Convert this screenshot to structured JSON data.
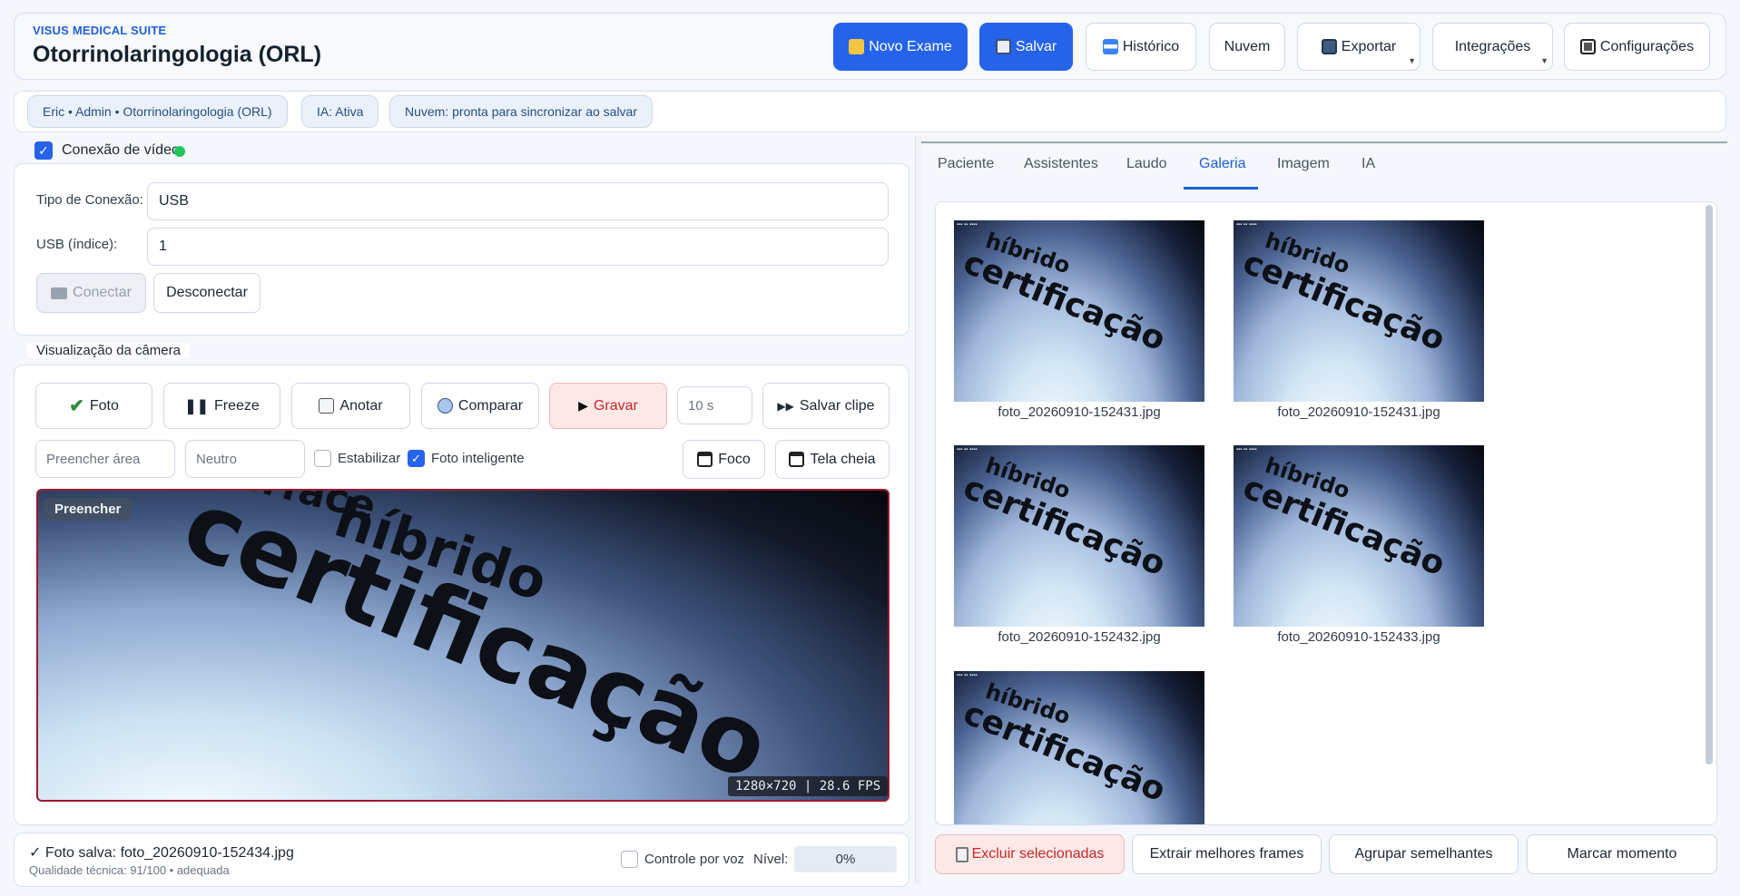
{
  "header": {
    "suite": "VISUS MEDICAL SUITE",
    "title": "Otorrinolaringologia (ORL)",
    "buttons": {
      "new_exam": "Novo Exame",
      "save": "Salvar",
      "history": "Histórico",
      "cloud": "Nuvem",
      "export": "Exportar",
      "integrations": "Integrações",
      "settings": "Configurações"
    }
  },
  "status_chips": {
    "user": "Eric • Admin • Otorrinolaringologia (ORL)",
    "ai": "IA: Ativa",
    "cloud": "Nuvem: pronta para sincronizar ao salvar"
  },
  "video_connection": {
    "label": "Conexão de vídeo",
    "enabled": true,
    "type_label": "Tipo de Conexão:",
    "type_value": "USB",
    "usb_label": "USB (índice):",
    "usb_value": "1",
    "connect": "Conectar",
    "disconnect": "Desconectar"
  },
  "camera": {
    "legend": "Visualização da câmera",
    "photo": "Foto",
    "freeze": "Freeze",
    "annotate": "Anotar",
    "compare": "Comparar",
    "record": "Gravar",
    "duration": "10 s",
    "save_clip": "Salvar clipe",
    "fill_mode": "Preencher área",
    "color_mode": "Neutro",
    "stabilize": "Estabilizar",
    "smart_photo": "Foto inteligente",
    "focus": "Foco",
    "fullscreen": "Tela cheia",
    "fill_badge": "Preencher",
    "stream_info": "1280×720 | 28.6 FPS",
    "video_text_lines": [
      "interface",
      "híbrido",
      "certificação"
    ]
  },
  "status": {
    "saved": "Foto salva: foto_20260910-152434.jpg",
    "quality": "Qualidade técnica: 91/100 • adequada",
    "voice_control": "Controle por voz",
    "level_label": "Nível:",
    "level_value": "0%"
  },
  "tabs": [
    "Paciente",
    "Assistentes",
    "Laudo",
    "Galeria",
    "Imagem",
    "IA"
  ],
  "active_tab": "Galeria",
  "gallery": {
    "thumb_text": [
      "híbrido",
      "certificação"
    ],
    "items": [
      "foto_20260910-152431.jpg",
      "foto_20260910-152431.jpg",
      "foto_20260910-152432.jpg",
      "foto_20260910-152433.jpg",
      ""
    ]
  },
  "gallery_actions": {
    "delete": "Excluir selecionadas",
    "extract": "Extrair melhores frames",
    "group": "Agrupar semelhantes",
    "mark": "Marcar momento"
  },
  "colors": {
    "primary": "#2563eb",
    "danger": "#c62828",
    "live": "#22c55e"
  }
}
